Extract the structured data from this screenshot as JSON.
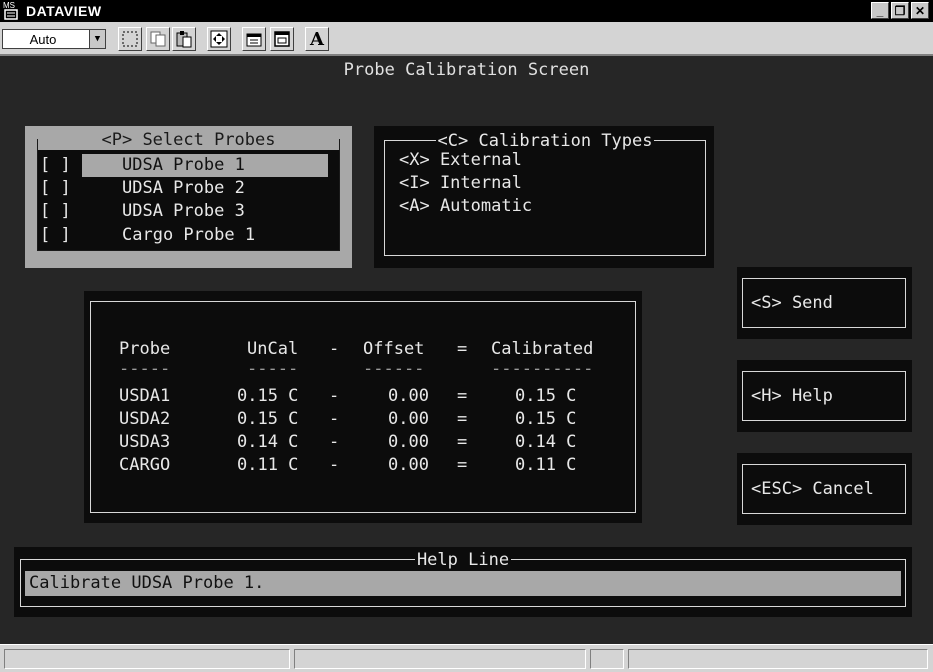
{
  "window": {
    "icon_text": "MS",
    "title": "DATAVIEW",
    "controls": [
      "_",
      "❐",
      "✕"
    ]
  },
  "toolbar": {
    "zoom_value": "Auto",
    "font_button_label": "A"
  },
  "screen": {
    "title": "Probe Calibration Screen"
  },
  "select_probes": {
    "legend": "<P> Select Probes",
    "items": [
      {
        "check": "[ ]",
        "label": "UDSA Probe 1"
      },
      {
        "check": "[ ]",
        "label": "UDSA Probe 2"
      },
      {
        "check": "[ ]",
        "label": "UDSA Probe 3"
      },
      {
        "check": "[ ]",
        "label": "Cargo Probe 1"
      }
    ]
  },
  "calibration_types": {
    "legend": "<C> Calibration Types",
    "items": [
      {
        "label": "<X> External"
      },
      {
        "label": "<I> Internal"
      },
      {
        "label": "<A> Automatic"
      }
    ]
  },
  "table": {
    "headers": [
      "Probe",
      "UnCal",
      "-",
      "Offset",
      "=",
      "Calibrated"
    ],
    "underline": [
      "-----",
      "-----",
      "",
      "------",
      "",
      "----------"
    ],
    "rows": [
      [
        "USDA1",
        "0.15 C",
        "-",
        "0.00",
        "=",
        "0.15 C"
      ],
      [
        "USDA2",
        "0.15 C",
        "-",
        "0.00",
        "=",
        "0.15 C"
      ],
      [
        "USDA3",
        "0.14 C",
        "-",
        "0.00",
        "=",
        "0.14 C"
      ],
      [
        "CARGO",
        "0.11 C",
        "-",
        "0.00",
        "=",
        "0.11 C"
      ]
    ]
  },
  "buttons": {
    "send": "<S> Send",
    "help": "<H> Help",
    "cancel": "<ESC> Cancel"
  },
  "help_line": {
    "legend": "Help Line",
    "text": "Calibrate UDSA Probe 1."
  }
}
